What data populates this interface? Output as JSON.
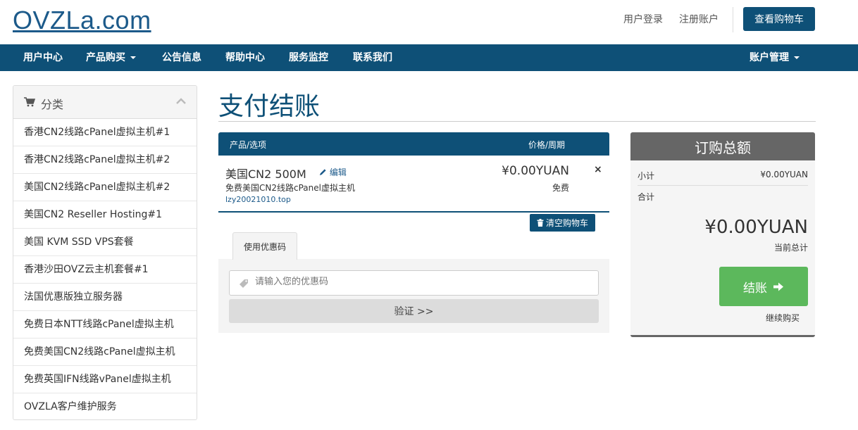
{
  "header": {
    "logo": "OVZLa.com",
    "login": "用户登录",
    "register": "注册账户",
    "view_cart": "查看购物车"
  },
  "nav": {
    "items": [
      {
        "label": "用户中心"
      },
      {
        "label": "产品购买"
      },
      {
        "label": "公告信息"
      },
      {
        "label": "帮助中心"
      },
      {
        "label": "服务监控"
      },
      {
        "label": "联系我们"
      }
    ],
    "account": "账户管理"
  },
  "sidebar": {
    "title": "分类",
    "items": [
      {
        "label": "香港CN2线路cPanel虚拟主机#1"
      },
      {
        "label": "香港CN2线路cPanel虚拟主机#2"
      },
      {
        "label": "美国CN2线路cPanel虚拟主机#2"
      },
      {
        "label": "美国CN2 Reseller Hosting#1"
      },
      {
        "label": "美国 KVM SSD VPS套餐"
      },
      {
        "label": "香港沙田OVZ云主机套餐#1"
      },
      {
        "label": "法国优惠版独立服务器"
      },
      {
        "label": "免费日本NTT线路cPanel虚拟主机"
      },
      {
        "label": "免费美国CN2线路cPanel虚拟主机"
      },
      {
        "label": "免费英国IFN线路vPanel虚拟主机"
      },
      {
        "label": "OVZLA客户维护服务"
      }
    ]
  },
  "main": {
    "title": "支付结账",
    "table": {
      "col_product": "产品/选项",
      "col_price": "价格/周期"
    },
    "item": {
      "name": "美国CN2 500M",
      "edit": "编辑",
      "description": "免费美国CN2线路cPanel虚拟主机",
      "domain": "lzy20021010.top",
      "price": "¥0.00YUAN",
      "cycle": "免费",
      "remove": "×"
    },
    "empty_cart": "清空购物车",
    "promo": {
      "tab": "使用优惠码",
      "placeholder": "请输入您的优惠码",
      "validate": "验证 >>"
    }
  },
  "summary": {
    "title": "订购总额",
    "subtotal_label": "小计",
    "subtotal_value": "¥0.00YUAN",
    "total_label": "合计",
    "total_value": "¥0.00YUAN",
    "total_caption": "当前总计",
    "checkout": "结账",
    "continue": "继续购买"
  },
  "colors": {
    "brand": "#0e5077",
    "success": "#5cb85c",
    "summary_head": "#666666"
  }
}
